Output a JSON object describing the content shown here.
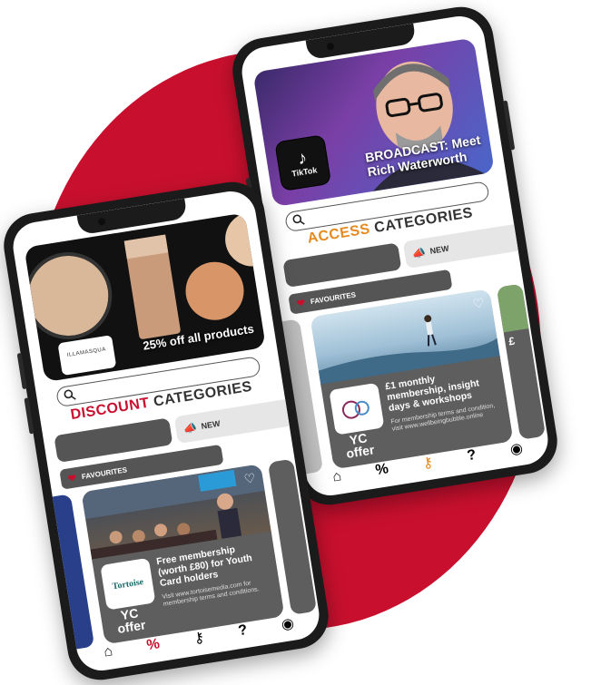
{
  "colors": {
    "brand_red": "#c8102e",
    "dark": "#1b1b1b",
    "gray": "#555555",
    "orange": "#e58a1f"
  },
  "back_phone": {
    "hero_badge": "TikTok",
    "hero_caption_line1": "BROADCAST: Meet",
    "hero_caption_line2": "Rich Waterworth",
    "category_accent": "ACCESS",
    "category_rest": " CATEGORIES",
    "new_label": "NEW",
    "favourites_label": "FAVOURITES",
    "card_title": "£1 monthly membership, insight days & workshops",
    "card_sub": "For membership terms and condition, visit www.wellbeingbubble.online",
    "offer_line1": "YC",
    "offer_line2": "offer",
    "side_card_text": "£",
    "nav": [
      "home-icon",
      "percent-icon",
      "key-icon",
      "help-icon",
      "profile-icon"
    ]
  },
  "front_phone": {
    "hero_brand": "ILLAMASQUA",
    "hero_caption": "25% off all products",
    "category_accent": "DISCOUNT",
    "category_rest": " CATEGORIES",
    "new_label": "NEW",
    "favourites_label": "FAVOURITES",
    "card_logo": "Tortoise",
    "card_title": "Free membership (worth £80) for Youth Card holders",
    "card_sub": "Visit www.tortoisemedia.com for membership terms and conditions.",
    "offer_line1": "YC",
    "offer_line2": "offer",
    "nav": [
      "home-icon",
      "percent-icon",
      "key-icon",
      "help-icon",
      "profile-icon"
    ]
  }
}
